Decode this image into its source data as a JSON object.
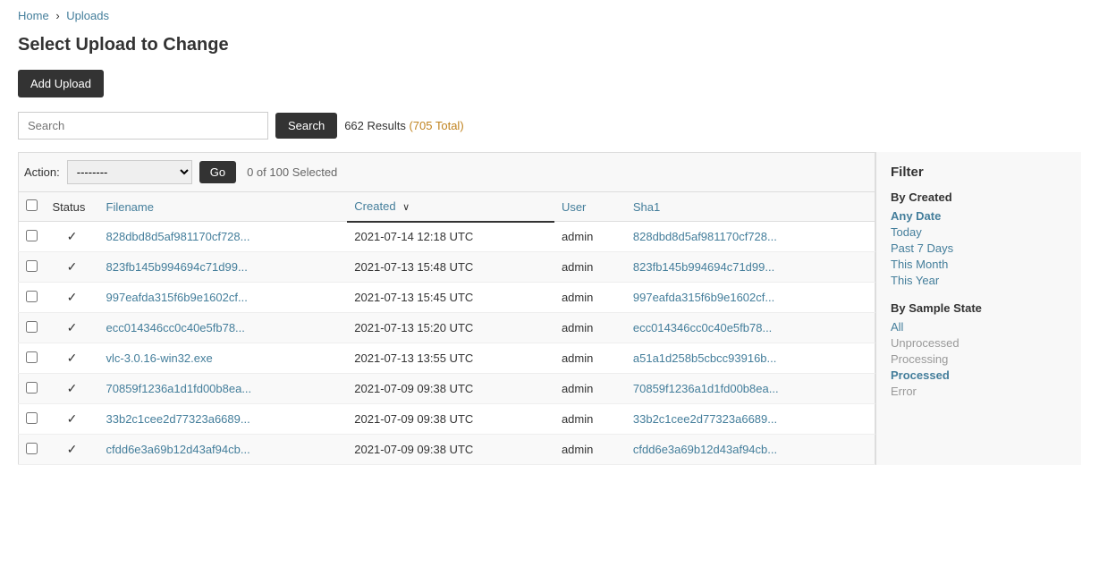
{
  "breadcrumb": {
    "home_label": "Home",
    "separator": "›",
    "current_label": "Uploads"
  },
  "page_title": "Select Upload to Change",
  "add_upload_btn": "Add Upload",
  "search": {
    "placeholder": "Search",
    "button_label": "Search",
    "results_text": "662 Results (705 Total)",
    "results_count": "662 Results ",
    "results_total": "(705 Total)"
  },
  "action_bar": {
    "label": "Action:",
    "select_default": "--------",
    "go_button": "Go",
    "selected_text": "0 of 100 Selected"
  },
  "table": {
    "columns": [
      "Status",
      "Filename",
      "Created",
      "User",
      "Sha1"
    ],
    "sort_col": "Created",
    "rows": [
      {
        "status": "✓",
        "filename": "828dbd8d5af981170cf728...",
        "created": "2021-07-14 12:18 UTC",
        "user": "admin",
        "sha1": "828dbd8d5af981170cf728..."
      },
      {
        "status": "✓",
        "filename": "823fb145b994694c71d99...",
        "created": "2021-07-13 15:48 UTC",
        "user": "admin",
        "sha1": "823fb145b994694c71d99..."
      },
      {
        "status": "✓",
        "filename": "997eafda315f6b9e1602cf...",
        "created": "2021-07-13 15:45 UTC",
        "user": "admin",
        "sha1": "997eafda315f6b9e1602cf..."
      },
      {
        "status": "✓",
        "filename": "ecc014346cc0c40e5fb78...",
        "created": "2021-07-13 15:20 UTC",
        "user": "admin",
        "sha1": "ecc014346cc0c40e5fb78..."
      },
      {
        "status": "✓",
        "filename": "vlc-3.0.16-win32.exe",
        "created": "2021-07-13 13:55 UTC",
        "user": "admin",
        "sha1": "a51a1d258b5cbcc93916b..."
      },
      {
        "status": "✓",
        "filename": "70859f1236a1d1fd00b8ea...",
        "created": "2021-07-09 09:38 UTC",
        "user": "admin",
        "sha1": "70859f1236a1d1fd00b8ea..."
      },
      {
        "status": "✓",
        "filename": "33b2c1cee2d77323a6689...",
        "created": "2021-07-09 09:38 UTC",
        "user": "admin",
        "sha1": "33b2c1cee2d77323a6689..."
      },
      {
        "status": "✓",
        "filename": "cfdd6e3a69b12d43af94cb...",
        "created": "2021-07-09 09:38 UTC",
        "user": "admin",
        "sha1": "cfdd6e3a69b12d43af94cb..."
      }
    ]
  },
  "filter": {
    "title": "Filter",
    "by_created_title": "By Created",
    "created_options": [
      {
        "label": "Any Date",
        "active": true
      },
      {
        "label": "Today",
        "active": false
      },
      {
        "label": "Past 7 Days",
        "active": false
      },
      {
        "label": "This Month",
        "active": false
      },
      {
        "label": "This Year",
        "active": false
      }
    ],
    "by_sample_state_title": "By Sample State",
    "sample_state_options": [
      {
        "label": "All",
        "active": false,
        "plain": false
      },
      {
        "label": "Unprocessed",
        "active": false,
        "plain": true
      },
      {
        "label": "Processing",
        "active": false,
        "plain": true
      },
      {
        "label": "Processed",
        "active": true,
        "plain": false
      },
      {
        "label": "Error",
        "active": false,
        "plain": true
      }
    ]
  }
}
